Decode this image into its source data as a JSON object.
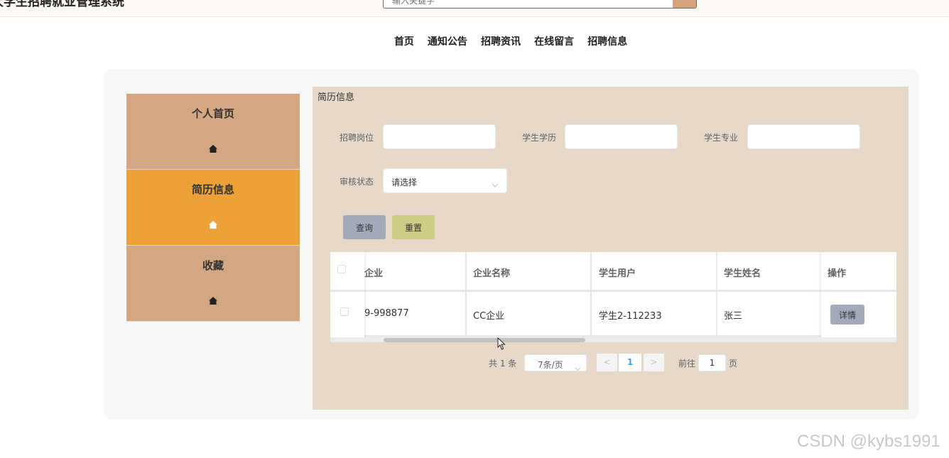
{
  "header": {
    "title": "大学生招聘就业管理系统",
    "search_placeholder": "输入关键字"
  },
  "nav": {
    "items": [
      "首页",
      "通知公告",
      "招聘资讯",
      "在线留言",
      "招聘信息"
    ]
  },
  "sidebar": {
    "items": [
      {
        "label": "个人首页",
        "icon": "home-icon",
        "active": false
      },
      {
        "label": "简历信息",
        "icon": "home-icon",
        "active": true
      },
      {
        "label": "收藏",
        "icon": "home-icon",
        "active": false
      }
    ]
  },
  "content": {
    "title": "简历信息",
    "filters": {
      "position_label": "招聘岗位",
      "education_label": "学生学历",
      "major_label": "学生专业",
      "status_label": "审核状态",
      "status_value": "请选择"
    },
    "buttons": {
      "query": "查询",
      "reset": "重置"
    },
    "table": {
      "columns": [
        "企业",
        "企业名称",
        "学生用户",
        "学生姓名",
        "操作"
      ],
      "rows": [
        {
          "enterprise": "9-998877",
          "enterprise_name": "CC企业",
          "student_user": "学生2-112233",
          "student_name": "张三",
          "action": "详情"
        }
      ]
    },
    "pagination": {
      "total": "共 1 条",
      "page_size": "7条/页",
      "prev": "<",
      "current_page": "1",
      "next": ">",
      "goto_label": "前往",
      "goto_value": "1",
      "goto_unit": "页"
    }
  },
  "watermark": "CSDN @kybs1991",
  "colors": {
    "sidebar_bg": "#d3a782",
    "sidebar_active": "#eca238",
    "content_bg": "#e6d9c9",
    "query_button": "#a3abbb",
    "reset_button": "#cdcd86",
    "page_active": "#409eff"
  }
}
